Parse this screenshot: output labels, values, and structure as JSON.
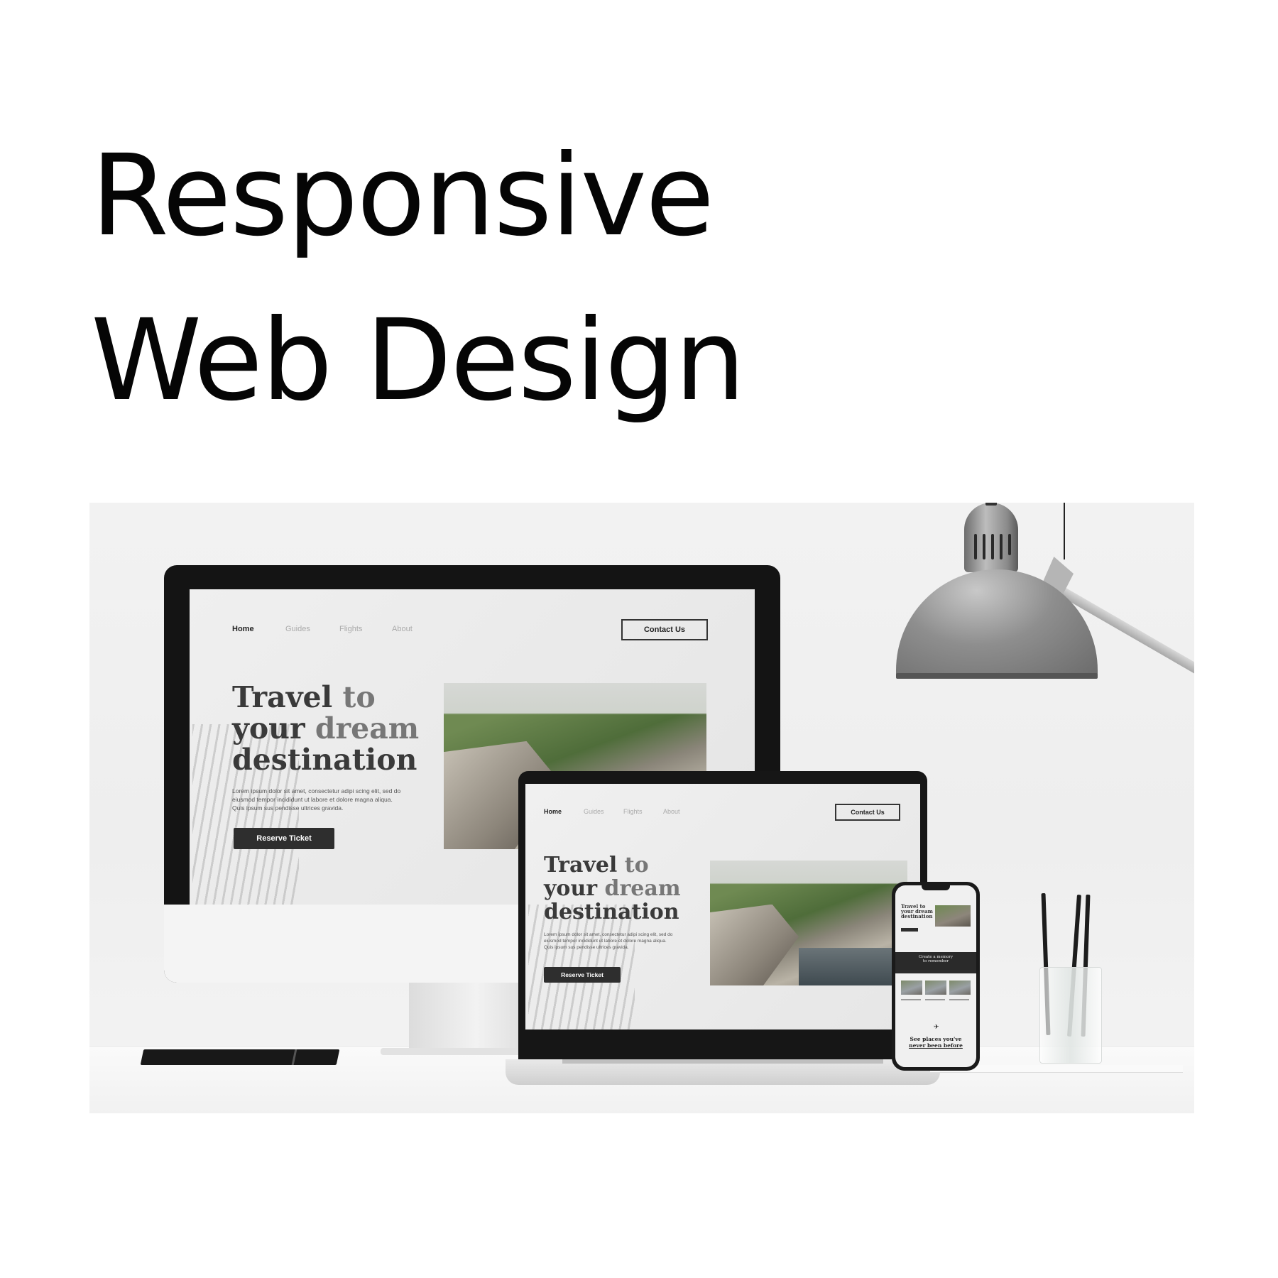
{
  "headline": {
    "line1": "Responsive",
    "line2": "Web Design"
  },
  "site": {
    "nav": [
      "Home",
      "Guides",
      "Flights",
      "About"
    ],
    "contact": "Contact Us",
    "hero": {
      "line1a": "Travel ",
      "line1b": "to",
      "line2a": "your ",
      "line2b": "dream",
      "line3": "destination"
    },
    "lorem": [
      "Lorem ipsum dolor sit amet, consectetur adipi scing elit, sed do",
      "eiusmod tempor incididunt ut labore et dolore magna aliqua.",
      "Quis ipsum sus pendisse ultrices gravida."
    ],
    "reserve": "Reserve Ticket"
  },
  "phone": {
    "hero": [
      "Travel to",
      "your dream",
      "destination"
    ],
    "band": [
      "Create a memory",
      "to remember"
    ],
    "see": [
      "See places you've",
      "never been before"
    ]
  },
  "colors": {
    "screen_bg": "#ececec",
    "button_dark": "#2e2e2e",
    "frame": "#141414"
  },
  "icons": [
    "desk-lamp-icon",
    "notebook-icon",
    "pen-holder-icon"
  ]
}
